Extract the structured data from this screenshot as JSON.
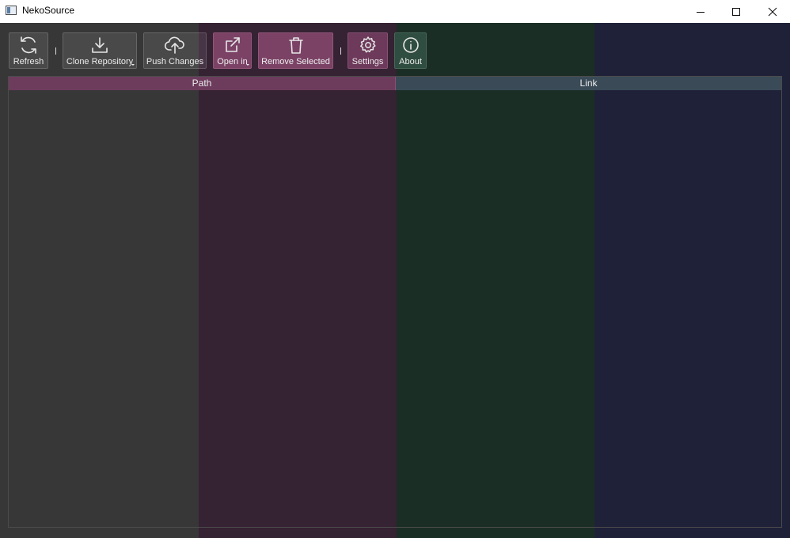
{
  "window": {
    "title": "NekoSource",
    "controls": [
      "minimize-icon",
      "maximize-icon",
      "close-icon"
    ]
  },
  "toolbar": {
    "buttons": [
      {
        "label": "Refresh",
        "icon": "refresh-icon"
      },
      {
        "label": "Clone Repository",
        "icon": "download-icon",
        "has_menu": true
      },
      {
        "label": "Push Changes",
        "icon": "cloud-upload-icon"
      },
      {
        "label": "Open in",
        "icon": "external-link-icon",
        "has_menu": true
      },
      {
        "label": "Remove Selected",
        "icon": "trash-icon"
      },
      {
        "label": "Settings",
        "icon": "gear-icon"
      },
      {
        "label": "About",
        "icon": "info-icon"
      }
    ]
  },
  "table": {
    "columns": [
      "Path",
      "Link"
    ],
    "rows": []
  },
  "colors": {
    "band_gray": "#373737",
    "band_pink": "#352233",
    "band_green": "#1b2e25",
    "band_blue": "#1f2139",
    "accent_pink": "#7b4266",
    "accent_green": "#2f4d40"
  }
}
